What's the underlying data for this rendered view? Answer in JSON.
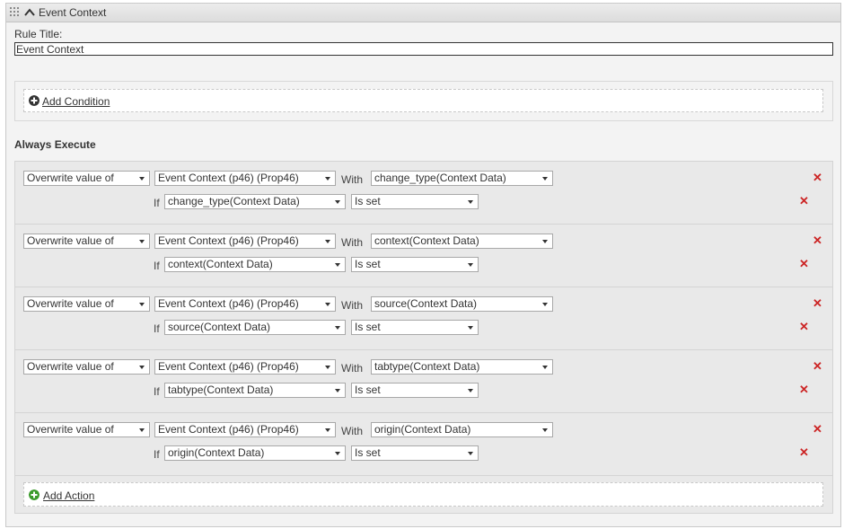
{
  "panel": {
    "title": "Event Context",
    "rule_title_label": "Rule Title:",
    "rule_title_value": "Event Context"
  },
  "conditions": {
    "add_condition_label": "Add Condition"
  },
  "always_execute_label": "Always Execute",
  "actions": [
    {
      "operation": "Overwrite value of",
      "target": "Event Context (p46) (Prop46)",
      "with_label": "With",
      "with_value": "change_type(Context Data)",
      "if_label": "If",
      "if_variable": "change_type(Context Data)",
      "if_condition": "Is set"
    },
    {
      "operation": "Overwrite value of",
      "target": "Event Context (p46) (Prop46)",
      "with_label": "With",
      "with_value": "context(Context Data)",
      "if_label": "If",
      "if_variable": "context(Context Data)",
      "if_condition": "Is set"
    },
    {
      "operation": "Overwrite value of",
      "target": "Event Context (p46) (Prop46)",
      "with_label": "With",
      "with_value": "source(Context Data)",
      "if_label": "If",
      "if_variable": "source(Context Data)",
      "if_condition": "Is set"
    },
    {
      "operation": "Overwrite value of",
      "target": "Event Context (p46) (Prop46)",
      "with_label": "With",
      "with_value": "tabtype(Context Data)",
      "if_label": "If",
      "if_variable": "tabtype(Context Data)",
      "if_condition": "Is set"
    },
    {
      "operation": "Overwrite value of",
      "target": "Event Context (p46) (Prop46)",
      "with_label": "With",
      "with_value": "origin(Context Data)",
      "if_label": "If",
      "if_variable": "origin(Context Data)",
      "if_condition": "Is set"
    }
  ],
  "add_action_label": "Add Action",
  "icons": {
    "delete": "close-icon",
    "add_condition": "plus-circle-icon",
    "add_action": "plus-circle-green-icon",
    "collapse": "chevron-up-icon",
    "drag": "grip-icon"
  },
  "colors": {
    "delete": "#cc2424",
    "add_action": "#3a9a2a",
    "add_condition": "#333333"
  }
}
